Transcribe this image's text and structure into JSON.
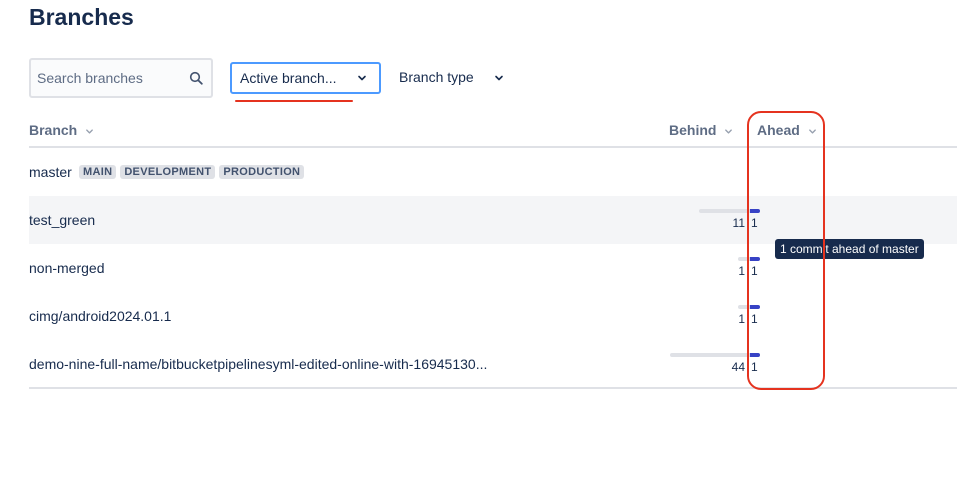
{
  "page": {
    "title": "Branches"
  },
  "filters": {
    "search_placeholder": "Search branches",
    "status_label": "Active branch...",
    "type_label": "Branch type"
  },
  "table": {
    "columns": {
      "branch": "Branch",
      "behind": "Behind",
      "ahead": "Ahead"
    },
    "rows": [
      {
        "name": "master",
        "lozenges": [
          "MAIN",
          "DEVELOPMENT",
          "PRODUCTION"
        ],
        "behind": "",
        "ahead": ""
      },
      {
        "name": "test_green",
        "lozenges": [],
        "behind": "11",
        "ahead": "1"
      },
      {
        "name": "non-merged",
        "lozenges": [],
        "behind": "1",
        "ahead": "1"
      },
      {
        "name": "cimg/android2024.01.1",
        "lozenges": [],
        "behind": "1",
        "ahead": "1"
      },
      {
        "name": "demo-nine-full-name/bitbucketpipelinesyml-edited-online-with-16945130...",
        "lozenges": [],
        "behind": "44",
        "ahead": "1"
      }
    ]
  },
  "tooltip": {
    "text": "1 commit ahead of master"
  },
  "colors": {
    "accent": "#3742c5",
    "focus": "#4c9aff",
    "annotation": "#e5331f",
    "text": "#172b4d"
  }
}
